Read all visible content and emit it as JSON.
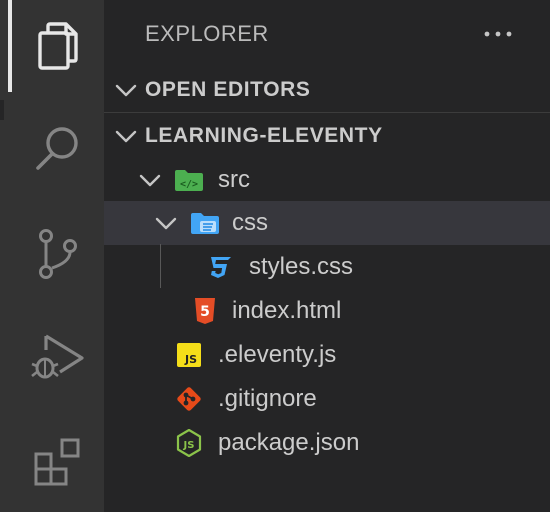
{
  "activity_bar": {
    "items": [
      {
        "id": "explorer",
        "icon": "files-icon",
        "active": true
      },
      {
        "id": "search",
        "icon": "search-icon",
        "active": false
      },
      {
        "id": "source-control",
        "icon": "source-control-icon",
        "active": false
      },
      {
        "id": "run-debug",
        "icon": "run-debug-icon",
        "active": false
      },
      {
        "id": "extensions",
        "icon": "extensions-icon",
        "active": false
      }
    ]
  },
  "explorer": {
    "title": "EXPLORER",
    "more_actions_icon": "ellipsis-icon"
  },
  "sections": {
    "open_editors": {
      "label": "OPEN EDITORS",
      "expanded": false
    },
    "project": {
      "label": "LEARNING-ELEVENTY",
      "expanded": true
    }
  },
  "tree": [
    {
      "name": "src",
      "type": "folder",
      "expanded": true,
      "icon": "folder-src-icon",
      "depth": 1
    },
    {
      "name": "css",
      "type": "folder",
      "expanded": true,
      "icon": "folder-css-icon",
      "depth": 2,
      "selected": true
    },
    {
      "name": "styles.css",
      "type": "file",
      "icon": "css-file-icon",
      "depth": 3
    },
    {
      "name": "index.html",
      "type": "file",
      "icon": "html-file-icon",
      "depth": 2
    },
    {
      "name": ".eleventy.js",
      "type": "file",
      "icon": "js-file-icon",
      "depth": 1
    },
    {
      "name": ".gitignore",
      "type": "file",
      "icon": "git-file-icon",
      "depth": 1
    },
    {
      "name": "package.json",
      "type": "file",
      "icon": "node-file-icon",
      "depth": 1
    }
  ],
  "colors": {
    "activity_bar_bg": "#333333",
    "sidebar_bg": "#252526",
    "selected_row_bg": "#37373d",
    "folder_src": "#4caf50",
    "folder_css": "#42a5f5",
    "css_icon": "#42a5f5",
    "html_icon": "#e44d26",
    "js_icon": "#f5de19",
    "git_icon": "#e64a19",
    "node_icon": "#8bc34a"
  }
}
